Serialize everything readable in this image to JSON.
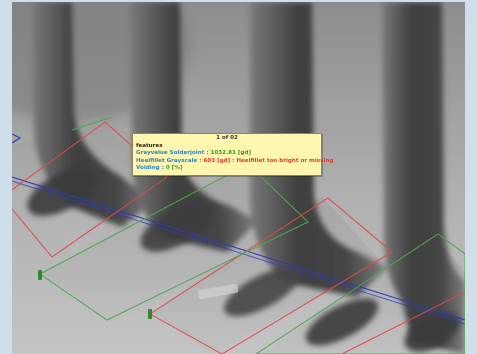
{
  "tooltip": {
    "counter": "1 of 02",
    "heading": "features",
    "rows": [
      {
        "label": "Grayvalue Solderjoint : ",
        "value": "1032.81 [gd]",
        "status": "ok"
      },
      {
        "label": "Heelfillet Grayscale : ",
        "value": "603 [gd] : Heelfillet too bright or missing",
        "status": "bad"
      },
      {
        "label": "Voiding : ",
        "value": "0 [%]",
        "status": "ok"
      }
    ]
  },
  "colors": {
    "frame": "#cfdeeb",
    "inspection_fail": "#e04848",
    "inspection_pass": "#4aa84a",
    "reference_line": "#2c3cb8",
    "handle": "#2e8a2e",
    "tooltip_bg": "#fff7b0"
  },
  "icons": [
    "handle-marker-icon"
  ]
}
